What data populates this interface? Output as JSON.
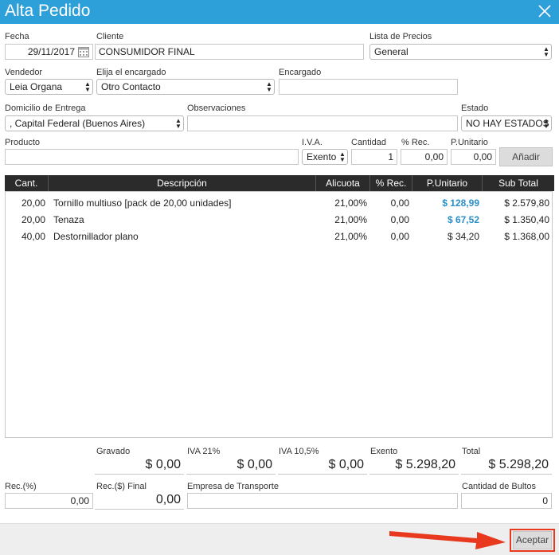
{
  "window": {
    "title": "Alta Pedido",
    "close_icon": "close-icon"
  },
  "form": {
    "fecha": {
      "label": "Fecha",
      "value": "29/11/2017"
    },
    "cliente": {
      "label": "Cliente",
      "value": "CONSUMIDOR FINAL"
    },
    "lista_precios": {
      "label": "Lista de Precios",
      "value": "General"
    },
    "vendedor": {
      "label": "Vendedor",
      "value": "Leia Organa"
    },
    "encargado_select": {
      "label": "Elija el encargado",
      "value": "Otro Contacto"
    },
    "encargado": {
      "label": "Encargado",
      "value": ""
    },
    "domicilio": {
      "label": "Domicilio de Entrega",
      "value": ", Capital Federal (Buenos Aires)"
    },
    "observaciones": {
      "label": "Observaciones",
      "value": ""
    },
    "estado": {
      "label": "Estado",
      "value": "NO HAY ESTADOS"
    },
    "producto": {
      "label": "Producto",
      "value": ""
    },
    "iva": {
      "label": "I.V.A.",
      "value": "Exento"
    },
    "cantidad": {
      "label": "Cantidad",
      "value": "1"
    },
    "rec": {
      "label": "% Rec.",
      "value": "0,00"
    },
    "punitario": {
      "label": "P.Unitario",
      "value": "0,00"
    },
    "add_button": "Añadir"
  },
  "table": {
    "headers": [
      "Cant.",
      "Descripción",
      "Alicuota",
      "% Rec.",
      "P.Unitario",
      "Sub Total"
    ],
    "rows": [
      {
        "cant": "20,00",
        "desc": "Tornillo multiuso [pack de 20,00 unidades]",
        "alicuota": "21,00%",
        "rec": "0,00",
        "punit": "$ 128,99",
        "punit_highlight": true,
        "subtotal": "$ 2.579,80"
      },
      {
        "cant": "20,00",
        "desc": "Tenaza",
        "alicuota": "21,00%",
        "rec": "0,00",
        "punit": "$ 67,52",
        "punit_highlight": true,
        "subtotal": "$ 1.350,40"
      },
      {
        "cant": "40,00",
        "desc": "Destornillador plano",
        "alicuota": "21,00%",
        "rec": "0,00",
        "punit": "$ 34,20",
        "punit_highlight": false,
        "subtotal": "$ 1.368,00"
      }
    ]
  },
  "totals": {
    "gravado": {
      "label": "Gravado",
      "value": "$ 0,00"
    },
    "iva21": {
      "label": "IVA 21%",
      "value": "$ 0,00"
    },
    "iva105": {
      "label": "IVA 10,5%",
      "value": "$ 0,00"
    },
    "exento": {
      "label": "Exento",
      "value": "$ 5.298,20"
    },
    "total": {
      "label": "Total",
      "value": "$ 5.298,20"
    }
  },
  "bottom": {
    "rec_pct": {
      "label": "Rec.(%)",
      "value": "0,00"
    },
    "rec_final": {
      "label": "Rec.($) Final",
      "value": "0,00"
    },
    "transporte": {
      "label": "Empresa de Transporte",
      "value": ""
    },
    "bultos": {
      "label": "Cantidad de Bultos",
      "value": "0"
    }
  },
  "footer": {
    "accept_label": "Aceptar"
  },
  "colors": {
    "title_bar": "#2d9fd9",
    "table_header": "#2b2b2b",
    "price_highlight": "#2a8fc9",
    "annotation": "#e8391e"
  }
}
